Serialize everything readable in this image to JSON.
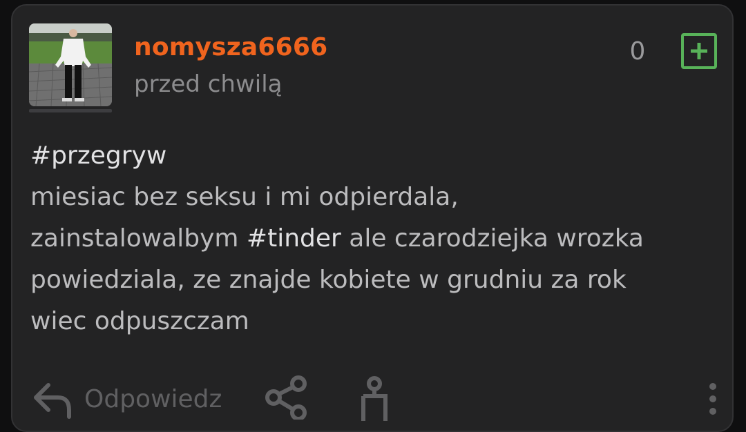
{
  "post": {
    "author": "nomysza6666",
    "timestamp": "przed chwilą",
    "vote_count": "0",
    "content": {
      "line1": "#przegryw",
      "line2": "miesiac bez seksu i mi odpierdala,",
      "line3_before": "zainstalowalbym ",
      "line3_tag": "#tinder",
      "line3_after": " ale czarodziejka wrozka",
      "line4": "powiedziala, ze znajde kobiete w grudniu za rok",
      "line5": "wiec odpuszczam"
    }
  },
  "footer": {
    "reply_label": "Odpowiedz"
  },
  "icons": {
    "plus": "plus-square-icon",
    "reply": "reply-arrow-icon",
    "share": "share-icon",
    "save": "save-icon",
    "more": "more-vertical-icon"
  },
  "colors": {
    "username": "#f0641e",
    "plus_accent": "#58b259",
    "card_bg": "#232324",
    "page_bg": "#0f0f10"
  }
}
